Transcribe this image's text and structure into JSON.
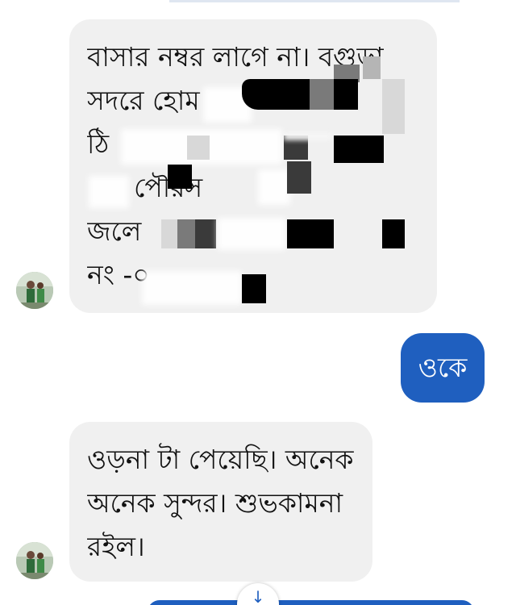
{
  "messages": [
    {
      "direction": "incoming",
      "lines": [
        "বাসার নম্বর লাগে না। বগুড়া",
        "সদরে হোম",
        "ঠি",
        "পৌরস",
        "জলে",
        "নং -০"
      ]
    },
    {
      "direction": "outgoing",
      "text": "ওকে"
    },
    {
      "direction": "incoming",
      "lines": [
        "ওড়না টা পেয়েছি। অনেক",
        "অনেক সুন্দর। শুভকামনা",
        "রইল।"
      ]
    }
  ],
  "scroll_down_icon": "chevron-down-icon",
  "colors": {
    "outgoing_bubble": "#1f5fbf",
    "incoming_bubble": "#f0f0f0",
    "background": "#ffffff"
  }
}
